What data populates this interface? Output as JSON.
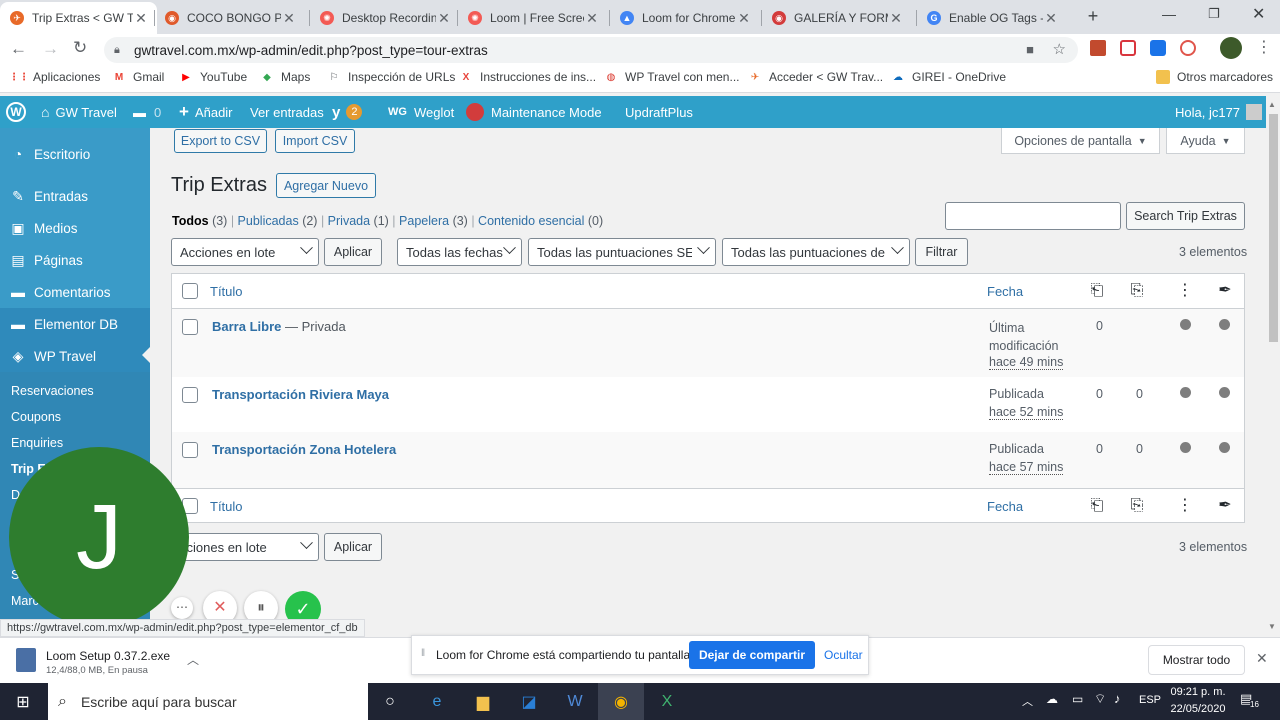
{
  "browser": {
    "tabs": [
      {
        "title": "Trip Extras < GW T",
        "fav_color": "#e86a29",
        "fav_glyph": "✈"
      },
      {
        "title": "COCO BONGO PL",
        "fav_color": "#e05a2b",
        "fav_glyph": "◉"
      },
      {
        "title": "Desktop Recording",
        "fav_color": "#f35a54",
        "fav_glyph": "✺"
      },
      {
        "title": "Loom | Free Scree",
        "fav_color": "#f35a54",
        "fav_glyph": "✺"
      },
      {
        "title": "Loom for Chrome",
        "fav_color": "#4285f4",
        "fav_glyph": "▲"
      },
      {
        "title": "GALERÍA Y FORMA",
        "fav_color": "#d33b3b",
        "fav_glyph": "◉"
      },
      {
        "title": "Enable OG Tags - I",
        "fav_color": "#4285f4",
        "fav_glyph": "G"
      }
    ],
    "new_tab": "+",
    "url": "gwtravel.com.mx/wp-admin/edit.php?post_type=tour-extras",
    "bookmarks": [
      {
        "label": "Aplicaciones",
        "glyph": "⋮⋮",
        "color": "#ea4335"
      },
      {
        "label": "Gmail",
        "glyph": "M",
        "color": "#ea4335"
      },
      {
        "label": "YouTube",
        "glyph": "▶",
        "color": "#ff0000"
      },
      {
        "label": "Maps",
        "glyph": "◆",
        "color": "#34a853"
      },
      {
        "label": "Inspección de URLs",
        "glyph": "⚐",
        "color": "#5f6368"
      },
      {
        "label": "Instrucciones de ins...",
        "glyph": "X",
        "color": "#e8453c"
      },
      {
        "label": "WP Travel con men...",
        "glyph": "◍",
        "color": "#d93025"
      },
      {
        "label": "Acceder < GW Trav...",
        "glyph": "✈",
        "color": "#e86a29"
      },
      {
        "label": "GIREI - OneDrive",
        "glyph": "☁",
        "color": "#0f6cbd"
      }
    ],
    "other_bookmarks": "Otros marcadores"
  },
  "adminbar": {
    "site": "GW Travel",
    "comments_count": "0",
    "add_new": "Añadir",
    "view_posts": "Ver entradas",
    "yoast_count": "2",
    "weglot_prefix": "WG",
    "weglot": "Weglot",
    "maintenance": "Maintenance Mode",
    "updraft": "UpdraftPlus",
    "greeting": "Hola, jc177"
  },
  "sidebar": {
    "items": [
      {
        "label": "Escritorio",
        "icon": "dashboard-icon",
        "glyph": "◔"
      },
      {
        "label": "Entradas",
        "icon": "pin-icon",
        "glyph": "✎"
      },
      {
        "label": "Medios",
        "icon": "media-icon",
        "glyph": "▣"
      },
      {
        "label": "Páginas",
        "icon": "pages-icon",
        "glyph": "▤"
      },
      {
        "label": "Comentarios",
        "icon": "comments-icon",
        "glyph": "▬"
      },
      {
        "label": "Elementor DB",
        "icon": "elementor-db-icon",
        "glyph": "▬"
      },
      {
        "label": "WP Travel",
        "icon": "compass-icon",
        "glyph": "◈"
      }
    ],
    "subitems": [
      "Reservaciones",
      "Coupons",
      "Enquiries",
      "Trip E",
      "D",
      "S",
      "Marc"
    ]
  },
  "page": {
    "export_csv": "Export to CSV",
    "import_csv": "Import CSV",
    "screen_options": "Opciones de pantalla",
    "help": "Ayuda",
    "title": "Trip Extras",
    "add_new": "Agregar Nuevo",
    "filters": {
      "all": "Todos",
      "all_count": "(3)",
      "published": "Publicadas",
      "published_count": "(2)",
      "private": "Privada",
      "private_count": "(1)",
      "trash": "Papelera",
      "trash_count": "(3)",
      "cornerstone": "Contenido esencial",
      "cornerstone_count": "(0)"
    },
    "search_button": "Search Trip Extras",
    "bulk_actions": "Acciones en lote",
    "bulk_actions_bottom": "cciones en lote",
    "apply": "Aplicar",
    "all_dates": "Todas las fechas",
    "seo_scores": "Todas las puntuaciones SEO",
    "readability_scores": "Todas las puntuaciones de",
    "filter": "Filtrar",
    "items_count": "3 elementos",
    "col_title": "Título",
    "col_date": "Fecha",
    "rows": [
      {
        "title": "Barra Libre",
        "state": "— Privada",
        "date_status": "Última modificación",
        "date_line2": "",
        "date_ago": "hace 49 mins",
        "links1": "0",
        "links2": ""
      },
      {
        "title": "Transportación Riviera Maya",
        "state": "",
        "date_status": "Publicada",
        "date_line2": "",
        "date_ago": "hace 52 mins",
        "links1": "0",
        "links2": "0"
      },
      {
        "title": "Transportación Zona Hotelera",
        "state": "",
        "date_status": "Publicada",
        "date_line2": "",
        "date_ago": "hace 57 mins",
        "links1": "0",
        "links2": "0"
      }
    ]
  },
  "loom": {
    "avatar_letter": "J",
    "avatar_color": "#2e7d2e",
    "sharing_text": "Loom for Chrome está compartiendo tu pantalla.",
    "stop_sharing": "Dejar de compartir",
    "hide": "Ocultar"
  },
  "status_url": "https://gwtravel.com.mx/wp-admin/edit.php?post_type=elementor_cf_db",
  "download": {
    "filename": "Loom Setup 0.37.2.exe",
    "progress_text": "12,4/88,0 MB, En pausa",
    "show_all": "Mostrar todo"
  },
  "taskbar": {
    "search_placeholder": "Escribe aquí para buscar",
    "language": "ESP",
    "time": "09:21 p. m.",
    "date": "22/05/2020",
    "notif_count": "16"
  }
}
